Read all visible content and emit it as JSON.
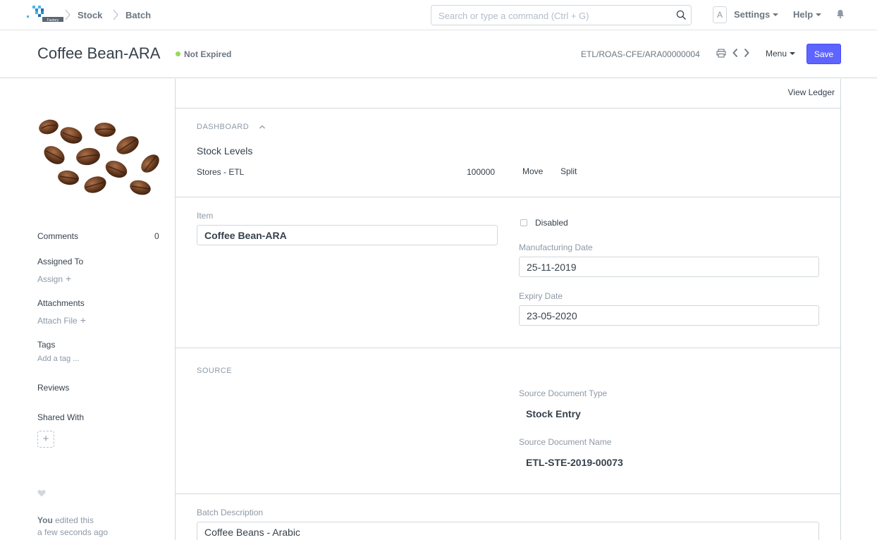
{
  "navbar": {
    "breadcrumbs": [
      "Stock",
      "Batch"
    ],
    "search_placeholder": "Search or type a command (Ctrl + G)",
    "avatar_letter": "A",
    "settings_label": "Settings",
    "help_label": "Help"
  },
  "page_head": {
    "title": "Coffee Bean-ARA",
    "status": "Not Expired",
    "status_color": "#98d85b",
    "doc_name": "ETL/ROAS-CFE/ARA00000004",
    "menu_label": "Menu",
    "save_label": "Save",
    "save_color": "#5e64ff"
  },
  "sidebar": {
    "comments_label": "Comments",
    "comments_count": "0",
    "assigned_to_label": "Assigned To",
    "assign_label": "Assign",
    "attachments_label": "Attachments",
    "attach_file_label": "Attach File",
    "tags_label": "Tags",
    "add_tag_label": "Add a tag ...",
    "reviews_label": "Reviews",
    "shared_with_label": "Shared With",
    "timeline_user": "You",
    "timeline_action": "edited this",
    "timeline_time": "a few seconds ago"
  },
  "main": {
    "view_ledger_label": "View Ledger",
    "dashboard": {
      "heading": "DASHBOARD",
      "stock_levels_title": "Stock Levels",
      "rows": [
        {
          "warehouse": "Stores - ETL",
          "qty": "100000",
          "move_label": "Move",
          "split_label": "Split"
        }
      ]
    },
    "fields": {
      "item_label": "Item",
      "item_value": "Coffee Bean-ARA",
      "disabled_label": "Disabled",
      "manufacturing_date_label": "Manufacturing Date",
      "manufacturing_date_value": "25-11-2019",
      "expiry_date_label": "Expiry Date",
      "expiry_date_value": "23-05-2020"
    },
    "source": {
      "heading": "SOURCE",
      "doc_type_label": "Source Document Type",
      "doc_type_value": "Stock Entry",
      "doc_name_label": "Source Document Name",
      "doc_name_value": "ETL-STE-2019-00073"
    },
    "description": {
      "label": "Batch Description",
      "value": "Coffee Beans - Arabic"
    }
  }
}
